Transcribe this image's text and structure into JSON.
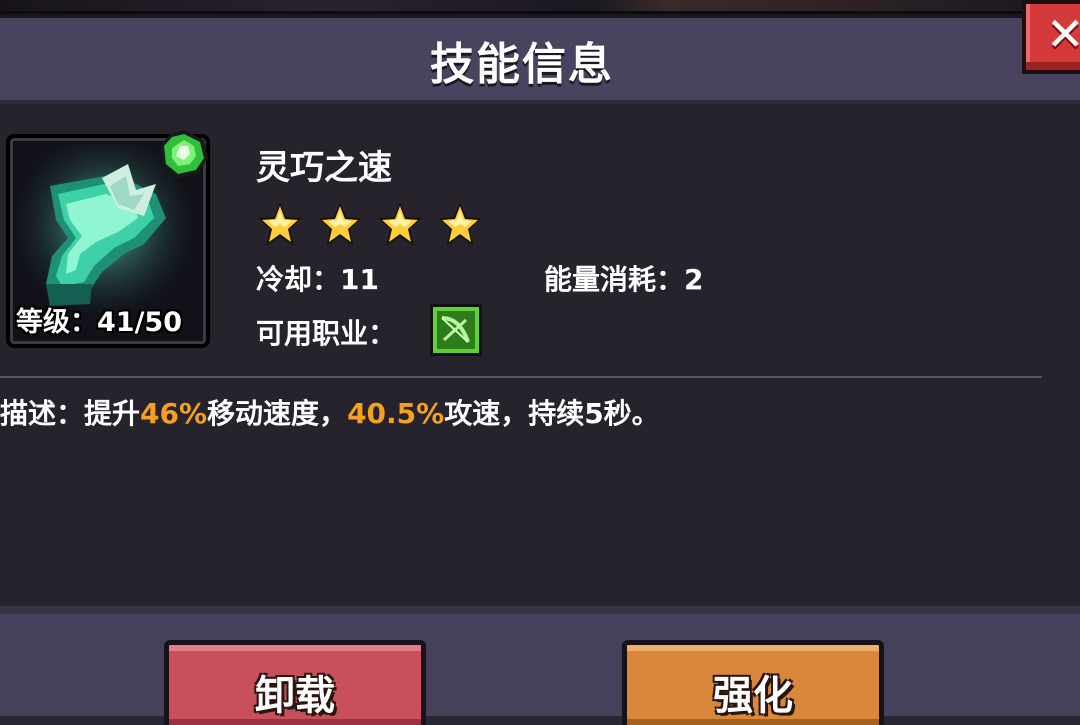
{
  "dialog": {
    "title": "技能信息",
    "close_icon": "close-icon"
  },
  "skill": {
    "name": "灵巧之速",
    "icon": "boots-icon",
    "badge_icon": "green-gem-badge-icon",
    "level_label": "等级：41/50",
    "stars": 4,
    "cooldown_label": "冷却：11",
    "energy_label": "能量消耗：2",
    "class_label": "可用职业：",
    "class_icon": "bow-class-icon"
  },
  "description": {
    "prefix": "描述：提升",
    "value1": "46%",
    "middle": "移动速度，",
    "value2": "40.5%",
    "suffix": "攻速，持续5秒。"
  },
  "buttons": {
    "unequip_label": "卸载",
    "upgrade_label": "强化"
  },
  "colors": {
    "highlight": "#f5a020",
    "unequip_button": "#c8505a",
    "upgrade_button": "#d9873a",
    "close_button": "#d43a3a"
  }
}
